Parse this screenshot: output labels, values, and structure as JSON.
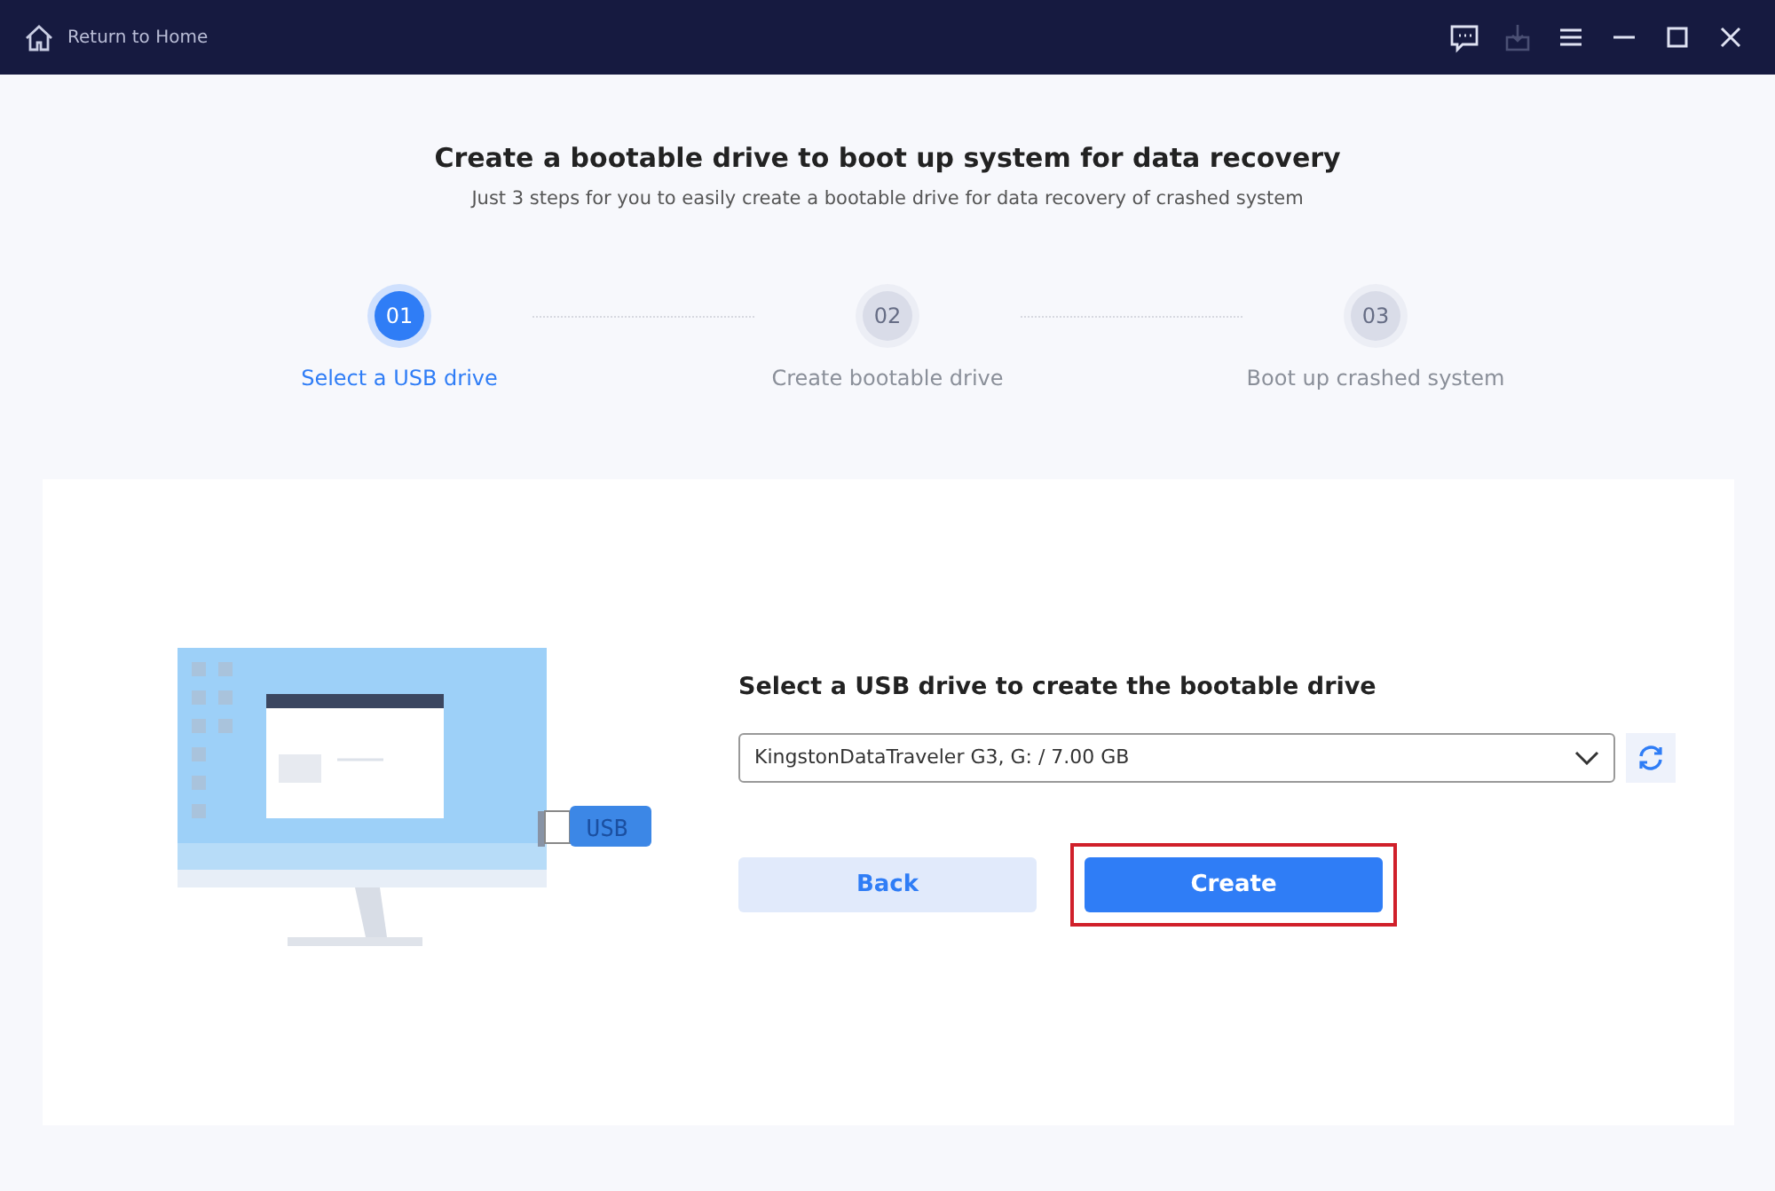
{
  "title_bar": {
    "home_link": "Return to Home",
    "tools": [
      {
        "kind": "feedback",
        "disabled": false
      },
      {
        "kind": "download",
        "disabled": true
      },
      {
        "kind": "menu",
        "disabled": false
      },
      {
        "kind": "minimize",
        "disabled": false
      },
      {
        "kind": "maximize",
        "disabled": false
      },
      {
        "kind": "close",
        "disabled": false
      }
    ]
  },
  "heading": "Create a bootable drive to boot up system for data recovery",
  "subheading": "Just 3 steps for you to easily create a bootable drive for data recovery of crashed system",
  "steps": [
    {
      "number": "01",
      "label": "Select a USB drive",
      "selected": true
    },
    {
      "number": "02",
      "label": "Create bootable drive",
      "selected": false
    },
    {
      "number": "03",
      "label": "Boot up crashed system",
      "selected": false
    }
  ],
  "illustration": {
    "usb_label": "USB"
  },
  "drive_picker": {
    "label": "Select a USB drive to create the bootable drive",
    "value": "KingstonDataTraveler G3, G: / 7.00 GB"
  },
  "buttons": [
    {
      "kind": "secondary",
      "label": "Back",
      "highlighted": false
    },
    {
      "kind": "primary",
      "label": "Create",
      "highlighted": true
    }
  ]
}
